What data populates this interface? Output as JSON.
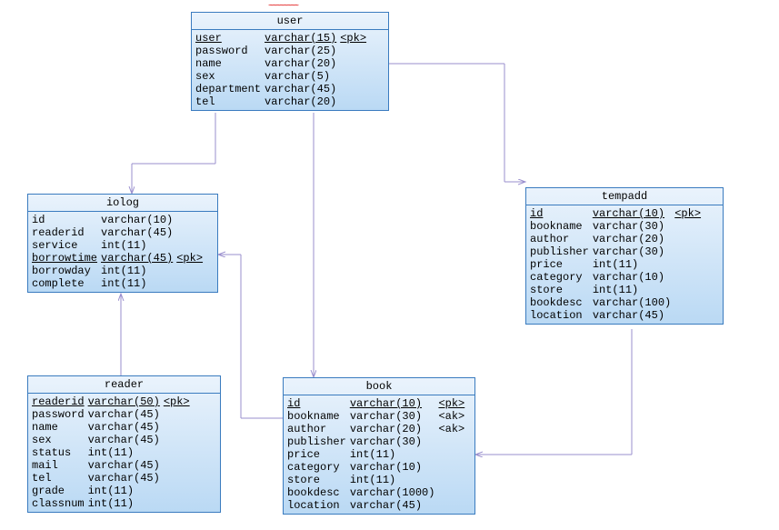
{
  "entities": {
    "user": {
      "title": "user",
      "rows": [
        {
          "name": "user",
          "type": "varchar(15)",
          "key": "<pk>",
          "pk": true
        },
        {
          "name": "password",
          "type": "varchar(25)",
          "key": ""
        },
        {
          "name": "name",
          "type": "varchar(20)",
          "key": ""
        },
        {
          "name": "sex",
          "type": "varchar(5)",
          "key": ""
        },
        {
          "name": "department",
          "type": "varchar(45)",
          "key": ""
        },
        {
          "name": "tel",
          "type": "varchar(20)",
          "key": ""
        }
      ]
    },
    "iolog": {
      "title": "iolog",
      "rows": [
        {
          "name": "id",
          "type": "varchar(10)",
          "key": ""
        },
        {
          "name": "readerid",
          "type": "varchar(45)",
          "key": ""
        },
        {
          "name": "service",
          "type": "int(11)",
          "key": ""
        },
        {
          "name": "borrowtime",
          "type": "varchar(45)",
          "key": "<pk>",
          "pk": true
        },
        {
          "name": "borrowday",
          "type": "int(11)",
          "key": ""
        },
        {
          "name": "complete",
          "type": "int(11)",
          "key": ""
        }
      ]
    },
    "tempadd": {
      "title": "tempadd",
      "rows": [
        {
          "name": "id",
          "type": "varchar(10)",
          "key": "<pk>",
          "pk": true
        },
        {
          "name": "bookname",
          "type": "varchar(30)",
          "key": ""
        },
        {
          "name": "author",
          "type": "varchar(20)",
          "key": ""
        },
        {
          "name": "publisher",
          "type": "varchar(30)",
          "key": ""
        },
        {
          "name": "price",
          "type": "int(11)",
          "key": ""
        },
        {
          "name": "category",
          "type": "varchar(10)",
          "key": ""
        },
        {
          "name": "store",
          "type": "int(11)",
          "key": ""
        },
        {
          "name": "bookdesc",
          "type": "varchar(100)",
          "key": ""
        },
        {
          "name": "location",
          "type": "varchar(45)",
          "key": ""
        }
      ]
    },
    "reader": {
      "title": "reader",
      "rows": [
        {
          "name": "readerid",
          "type": "varchar(50)",
          "key": "<pk>",
          "pk": true
        },
        {
          "name": "password",
          "type": "varchar(45)",
          "key": ""
        },
        {
          "name": "name",
          "type": "varchar(45)",
          "key": ""
        },
        {
          "name": "sex",
          "type": "varchar(45)",
          "key": ""
        },
        {
          "name": "status",
          "type": "int(11)",
          "key": ""
        },
        {
          "name": "mail",
          "type": "varchar(45)",
          "key": ""
        },
        {
          "name": "tel",
          "type": "varchar(45)",
          "key": ""
        },
        {
          "name": "grade",
          "type": "int(11)",
          "key": ""
        },
        {
          "name": "classnum",
          "type": "int(11)",
          "key": ""
        }
      ]
    },
    "book": {
      "title": "book",
      "rows": [
        {
          "name": "id",
          "type": "varchar(10)",
          "key": "<pk>",
          "pk": true
        },
        {
          "name": "bookname",
          "type": "varchar(30)",
          "key": "<ak>"
        },
        {
          "name": "author",
          "type": "varchar(20)",
          "key": "<ak>"
        },
        {
          "name": "publisher",
          "type": "varchar(30)",
          "key": ""
        },
        {
          "name": "price",
          "type": "int(11)",
          "key": ""
        },
        {
          "name": "category",
          "type": "varchar(10)",
          "key": ""
        },
        {
          "name": "store",
          "type": "int(11)",
          "key": ""
        },
        {
          "name": "bookdesc",
          "type": "varchar(1000)",
          "key": ""
        },
        {
          "name": "location",
          "type": "varchar(45)",
          "key": ""
        }
      ]
    }
  }
}
